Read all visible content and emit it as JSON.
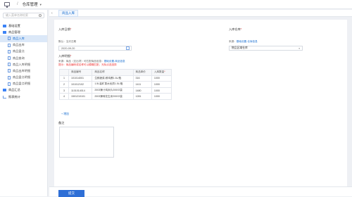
{
  "topbar": {
    "app_name": "仓库管理",
    "separator": "/"
  },
  "sidebar": {
    "search_placeholder": "输入菜单名称检索",
    "items": [
      {
        "label": "基础设置",
        "icon": "folder-icon",
        "level": 0
      },
      {
        "label": "商品管理",
        "icon": "folder-icon",
        "level": 0
      },
      {
        "label": "商品入库",
        "icon": "document-icon",
        "level": 1,
        "active": true
      },
      {
        "label": "商品出库",
        "icon": "document-icon",
        "level": 1
      },
      {
        "label": "商品盘点",
        "icon": "document-icon",
        "level": 1
      },
      {
        "label": "商品查询",
        "icon": "document-icon",
        "level": 1
      },
      {
        "label": "商品入库明细",
        "icon": "document-icon",
        "level": 1
      },
      {
        "label": "商品出库明细",
        "icon": "document-icon",
        "level": 1
      },
      {
        "label": "商品盘点明细",
        "icon": "document-icon",
        "level": 1
      },
      {
        "label": "商品盘点明细",
        "icon": "document-icon",
        "level": 1
      },
      {
        "label": "商品汇总",
        "icon": "folder-icon",
        "level": 0
      },
      {
        "label": "报表统计",
        "icon": "chart-icon",
        "level": 0
      }
    ]
  },
  "tabs": {
    "active_label": "商品入库"
  },
  "form": {
    "date_label": "入库日期",
    "date_hint": "默认：当天日期",
    "date_value": "2020-09-20",
    "warehouse_label": "入库仓库",
    "warehouse_hint_prefix": "来源：",
    "warehouse_hint_link": "基础设置-仓库信息",
    "warehouse_value": "物品区域仓库",
    "goods_label": "入库明细",
    "goods_hint1_prefix": "来源：商品（支出项）可匹配商品信息：",
    "goods_hint1_link": "基础设置-商品信息",
    "goods_hint2": "提示：商品编码或名称可以模糊匹配，光标点选选择",
    "columns": [
      "",
      "商品编号",
      "商品名称",
      "商品单价",
      "入库数量"
    ],
    "required_mark": "*",
    "rows": [
      [
        "1",
        "101014001",
        "生鲜蔬菜-鲜鸡蛋1.5L/瓶",
        "316",
        "1000"
      ],
      [
        "2",
        "101012102",
        "1.5L装矿泉水优质1.5L/瓶",
        "1411",
        "1000"
      ],
      [
        "3",
        "1101014014",
        "2003辣汁鸡米片200G/袋",
        "1480",
        "1000"
      ],
      [
        "4",
        "1501210101",
        "2003辣味花生米200G/袋",
        "1281",
        "1000"
      ]
    ],
    "add_row_label": "+ 增加",
    "remark_label": "备注"
  },
  "footer": {
    "submit_label": "提交"
  },
  "colors": {
    "accent": "#2f6fd6",
    "active_bg": "#dbe8f8",
    "required": "#e33333"
  }
}
